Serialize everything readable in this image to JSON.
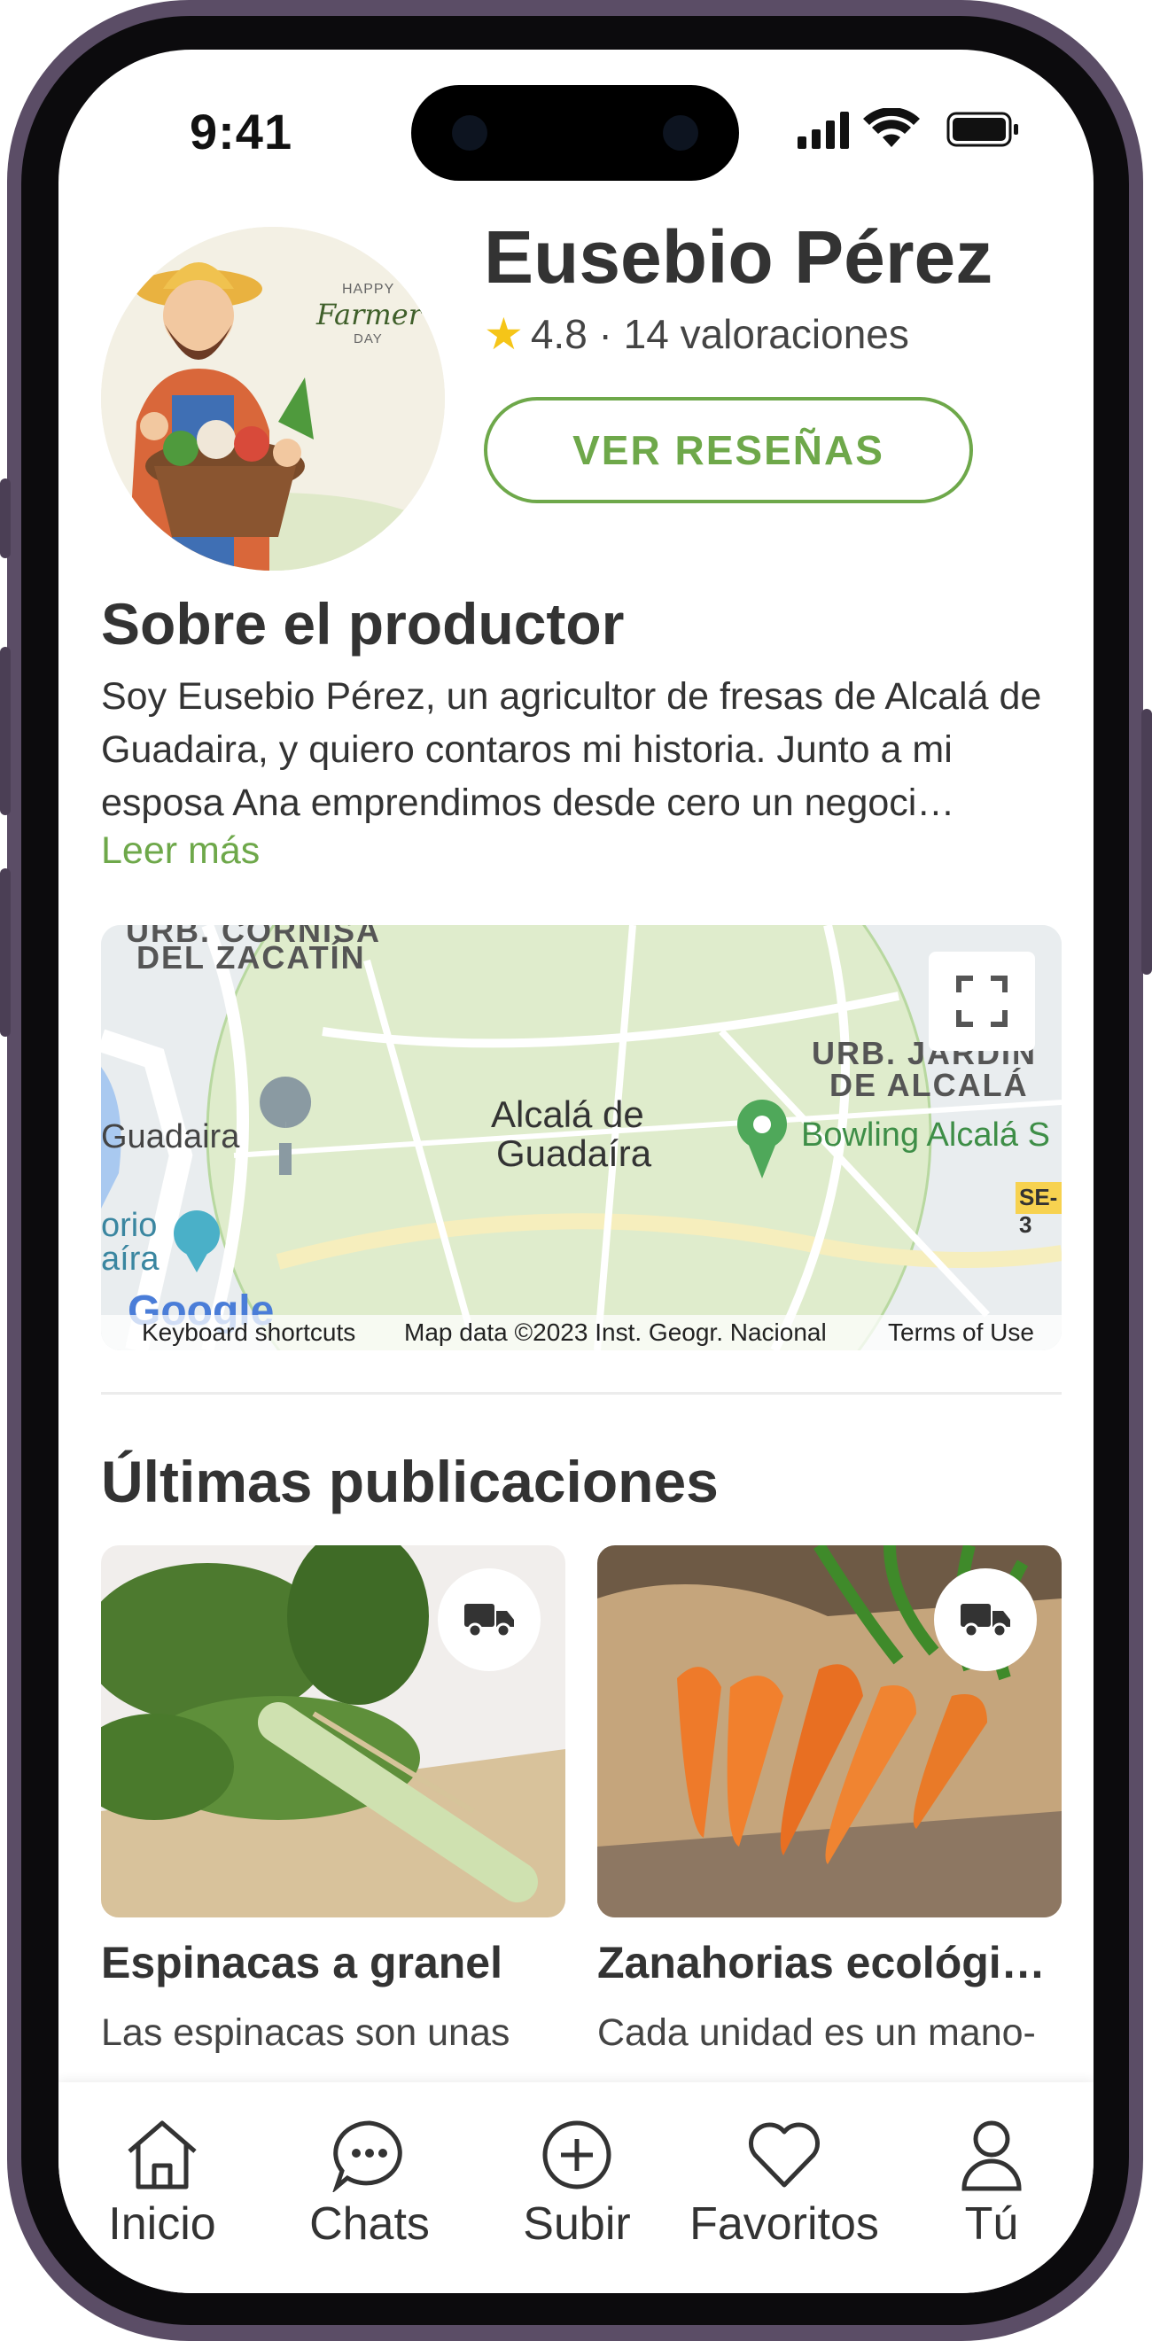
{
  "status_bar": {
    "time": "9:41"
  },
  "producer": {
    "name": "Eusebio Pérez",
    "rating_text": "4.8 · 14 valoraciones",
    "reviews_button": "VER RESEÑAS",
    "avatar_art": {
      "small_text": "HAPPY",
      "brand_text": "Farmer's",
      "sub_text": "DAY"
    }
  },
  "about": {
    "title": "Sobre el productor",
    "text": "Soy Eusebio Pérez, un agricultor de fresas de Alcalá de Guadaira, y quiero contaros mi historia. Junto a mi esposa Ana emprendimos desde cero un negoci…",
    "read_more": "Leer más"
  },
  "map": {
    "labels": {
      "urb_top": "URB. CORNISA",
      "zacatin": "DEL ZACATÍN",
      "urb_right": "URB. JARDIN",
      "urb_right2": "DE ALCALÁ",
      "city": "Alcalá de",
      "city2": "Guadaíra",
      "guadaira": "Guadaira",
      "bowling": "Bowling Alcalá S",
      "road": "SE-3",
      "orio": "orio",
      "aira": "aíra"
    },
    "attribution": {
      "shortcuts": "Keyboard shortcuts",
      "data": "Map data ©2023 Inst. Geogr. Nacional",
      "terms": "Terms of Use",
      "logo": "Google"
    }
  },
  "latest": {
    "title": "Últimas publicaciones",
    "items": [
      {
        "title": "Espinacas a granel",
        "desc": "Las espinacas son unas",
        "badge_icon": "truck-icon"
      },
      {
        "title": "Zanahorias ecológic…",
        "desc": "Cada unidad es un mano-",
        "badge_icon": "truck-icon"
      }
    ]
  },
  "tabbar": {
    "items": [
      {
        "label": "Inicio",
        "icon": "home-icon"
      },
      {
        "label": "Chats",
        "icon": "chat-icon"
      },
      {
        "label": "Subir",
        "icon": "plus-circle-icon"
      },
      {
        "label": "Favoritos",
        "icon": "heart-icon"
      },
      {
        "label": "Tú",
        "icon": "user-icon"
      }
    ]
  },
  "colors": {
    "accent": "#6ea84a",
    "text": "#333333",
    "star": "#f5c518"
  }
}
